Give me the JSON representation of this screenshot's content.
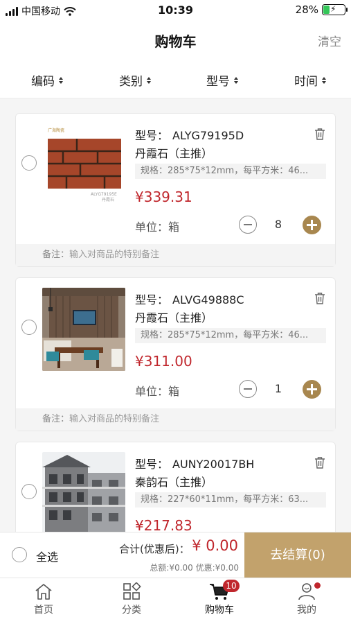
{
  "status_bar": {
    "carrier": "中国移动",
    "time": "10:39",
    "battery_percent": "28%",
    "battery_level": 0.28
  },
  "nav": {
    "title": "购物车",
    "clear_label": "清空"
  },
  "sort_bar": {
    "items": [
      "编码",
      "类别",
      "型号",
      "时间"
    ]
  },
  "cart": {
    "model_label": "型号：",
    "remark_label": "备注：",
    "remark_placeholder": "输入对商品的特别备注",
    "items": [
      {
        "model": "ALYG79195D",
        "series": "丹霞石（主推）",
        "spec": "规格：285*75*12mm，每平方米：46...",
        "price": "¥339.31",
        "unit": "单位：箱",
        "quantity": "8",
        "image_caption": "ALYG79195E",
        "image_subcaption": "丹霞石",
        "image_brand": "广海陶瓷"
      },
      {
        "model": "ALVG49888C",
        "series": "丹霞石（主推）",
        "spec": "规格：285*75*12mm，每平方米：46...",
        "price": "¥311.00",
        "unit": "单位：箱",
        "quantity": "1"
      },
      {
        "model": "AUNY20017BH",
        "series": "秦韵石（主推）",
        "spec": "规格：227*60*11mm，每平方米：63...",
        "price": "¥217.83"
      }
    ]
  },
  "checkout": {
    "select_all_label": "全选",
    "total_label": "合计(优惠后)：",
    "total_value": "¥ 0.00",
    "sub_info": "总额:¥0.00  优惠:¥0.00",
    "checkout_button": "去结算(0)"
  },
  "tab_bar": {
    "tabs": [
      {
        "label": "首页",
        "icon": "home-icon"
      },
      {
        "label": "分类",
        "icon": "category-icon"
      },
      {
        "label": "购物车",
        "icon": "cart-icon",
        "badge": "10"
      },
      {
        "label": "我的",
        "icon": "user-icon"
      }
    ]
  },
  "colors": {
    "accent": "#c2a26c",
    "price": "#c0272d",
    "badge": "#c0272d"
  }
}
